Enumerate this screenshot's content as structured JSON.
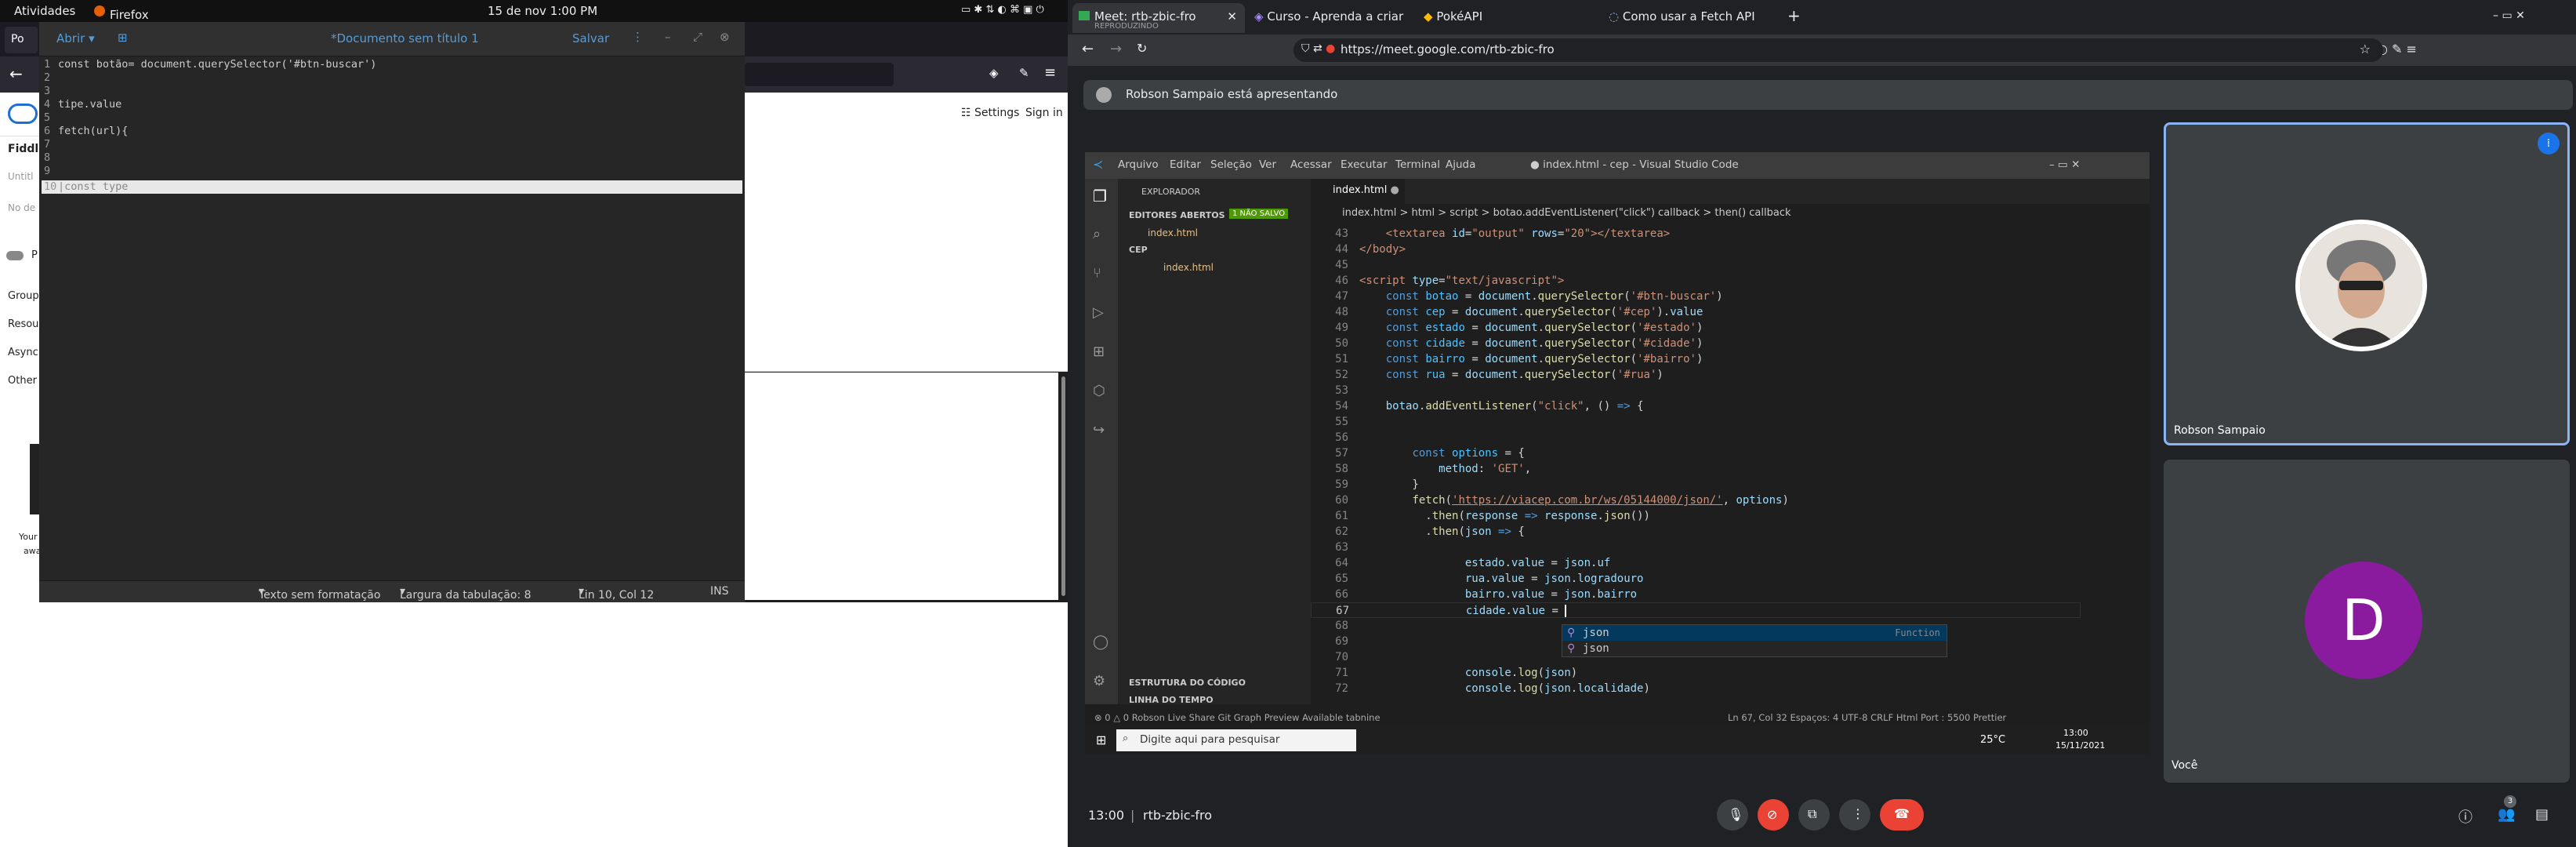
{
  "topbar": {
    "activities": "Atividades",
    "app": "Firefox",
    "clock": "15 de nov  1:00 PM"
  },
  "firefox": {
    "tab_label": "Po",
    "fiddle_title": "Fiddle",
    "settings": "Settings",
    "sign_in": "Sign in",
    "sidebar_items": [
      "Group",
      "Resou",
      "Async",
      "Other"
    ],
    "untitled": "Untitl",
    "no_desc": "No de",
    "toggle_label": "P",
    "footer_a": "Your",
    "footer_b": "awa"
  },
  "gedit": {
    "open": "Abrir",
    "title": "*Documento sem título 1",
    "save": "Salvar",
    "lines": [
      {
        "n": "1",
        "text": "const botão= document.querySelector('#btn-buscar')"
      },
      {
        "n": "2",
        "text": ""
      },
      {
        "n": "3",
        "text": ""
      },
      {
        "n": "4",
        "text": "tipe.value"
      },
      {
        "n": "5",
        "text": ""
      },
      {
        "n": "6",
        "text": "fetch(url){"
      },
      {
        "n": "7",
        "text": ""
      },
      {
        "n": "8",
        "text": ""
      },
      {
        "n": "9",
        "text": ""
      },
      {
        "n": "10",
        "text": "|const type"
      }
    ],
    "status": {
      "format": "Texto sem formatação",
      "tab_width": "Largura da tabulação: 8",
      "position": "Lin 10, Col 12",
      "mode": "INS"
    }
  },
  "chrome": {
    "tabs": [
      {
        "title": "Meet: rtb-zbic-fro",
        "sub": "REPRODUZINDO"
      },
      {
        "title": "Curso - Aprenda a criar u"
      },
      {
        "title": "PokéAPI"
      },
      {
        "title": "Como usar a Fetch API do"
      }
    ],
    "new_tab": "+",
    "url": "https://meet.google.com/rtb-zbic-fro"
  },
  "meet": {
    "presenting": "Robson Sampaio está apresentando",
    "participant1": "Robson Sampaio",
    "participant2": "Você",
    "participant2_initial": "D",
    "time": "13:00",
    "code": "rtb-zbic-fro",
    "people_count": "3",
    "colors": {
      "leave": "#ea4335",
      "accent": "#8ab4f8",
      "avatar_d": "#8a1b9e"
    }
  },
  "vscode": {
    "menu": [
      "Arquivo",
      "Editar",
      "Seleção",
      "Ver",
      "Acessar",
      "Executar",
      "Terminal",
      "Ajuda"
    ],
    "window_title": "● index.html - cep - Visual Studio Code",
    "explorer": "EXPLORADOR",
    "open_editors": "EDITORES ABERTOS",
    "unsaved_badge": "1 NÃO SALVO",
    "open_file": "index.html",
    "folder": "CEP",
    "folder_file": "index.html",
    "outline": "ESTRUTURA DO CÓDIGO",
    "timeline": "LINHA DO TEMPO",
    "tab": "index.html",
    "breadcrumb": "index.html  >  html  >  script  >  botao.addEventListener(\"click\") callback  >  then() callback",
    "autocomplete": [
      {
        "label": "json",
        "detail": "Function"
      },
      {
        "label": "json"
      }
    ],
    "status_left": "⊗ 0 △ 0    Robson    Live Share    Git Graph    Preview Available    tabnine",
    "status_right": "Ln 67, Col 32    Espaços: 4    UTF-8    CRLF    Html    Port : 5500    Prettier"
  },
  "taskbar": {
    "search": "Digite aqui para pesquisar",
    "weather": "25°C",
    "time": "13:00",
    "date": "15/11/2021"
  }
}
